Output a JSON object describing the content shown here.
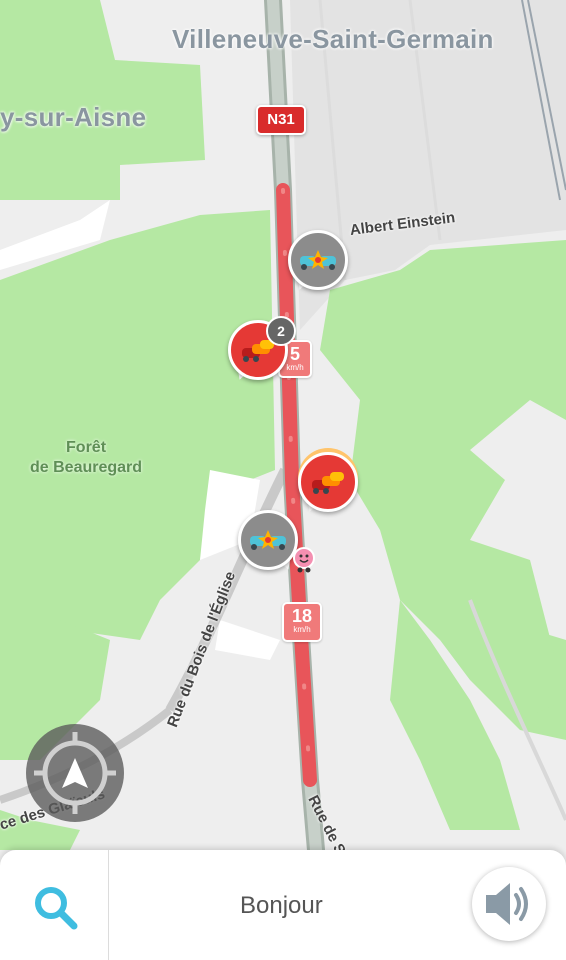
{
  "map": {
    "places": {
      "town_top": "Villeneuve-Saint-Germain",
      "town_left": "y-sur-Aisne",
      "forest": [
        "Forêt",
        "de Beauregard"
      ]
    },
    "road_shield": "N31",
    "streets": {
      "einstein": "Albert Einstein",
      "eglise": "Rue du Bois de l'Église",
      "glaieuls": "ce des Glaïeuls",
      "soissons": "Rue de Sois"
    },
    "speed_labels": [
      {
        "value": "5",
        "unit": "km/h"
      },
      {
        "value": "18",
        "unit": "km/h"
      }
    ],
    "reports": [
      {
        "type": "accident",
        "icon": "accident-icon",
        "color": "#8c8c8c"
      },
      {
        "type": "traffic-jam",
        "icon": "traffic-jam-icon",
        "color": "#e53935",
        "count": "2"
      },
      {
        "type": "traffic-jam",
        "icon": "traffic-jam-icon",
        "color": "#e53935"
      },
      {
        "type": "accident",
        "icon": "accident-icon",
        "color": "#8c8c8c"
      }
    ],
    "colors": {
      "forest": "#b5e8a3",
      "traffic": "#e8555a",
      "background": "#eeeeee"
    }
  },
  "bottom_bar": {
    "search_icon": "search-icon",
    "greeting": "Bonjour",
    "sound_icon": "speaker-icon"
  },
  "recenter_icon": "recenter-icon"
}
